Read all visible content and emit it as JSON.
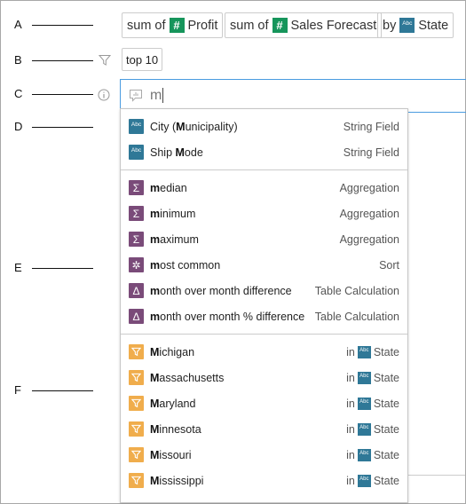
{
  "labels": [
    "A",
    "B",
    "C",
    "D",
    "E",
    "F"
  ],
  "pills": [
    {
      "prefix": "sum of",
      "icon": "number-icon",
      "icon_text": "#",
      "field": "Profit"
    },
    {
      "prefix": "sum of",
      "icon": "number-icon",
      "icon_text": "#",
      "field": "Sales Forecast"
    },
    {
      "prefix": "by",
      "icon": "string-icon",
      "icon_text": "Abc",
      "field": "State"
    }
  ],
  "filter_pill": "top 10",
  "input": {
    "value": "m"
  },
  "colors": {
    "number": "#16955b",
    "string": "#2f7897",
    "aggregation": "#7a4b79",
    "filter": "#f0ad4c",
    "focus": "#4a9ce0"
  },
  "sections": [
    [
      {
        "icon": "string-icon",
        "icon_text": "Abc",
        "pre": "City (",
        "match": "M",
        "post": "unicipality)",
        "type": "String Field"
      },
      {
        "icon": "string-icon",
        "icon_text": "Abc",
        "pre": "Ship ",
        "match": "M",
        "post": "ode",
        "type": "String Field"
      }
    ],
    [
      {
        "icon": "sigma-icon",
        "icon_text": "Σ",
        "pre": "",
        "match": "m",
        "post": "edian",
        "type": "Aggregation"
      },
      {
        "icon": "sigma-icon",
        "icon_text": "Σ",
        "pre": "",
        "match": "m",
        "post": "inimum",
        "type": "Aggregation"
      },
      {
        "icon": "sigma-icon",
        "icon_text": "Σ",
        "pre": "",
        "match": "m",
        "post": "aximum",
        "type": "Aggregation"
      },
      {
        "icon": "sort-icon",
        "icon_text": "✲",
        "pre": "",
        "match": "m",
        "post": "ost common",
        "type": "Sort"
      },
      {
        "icon": "delta-icon",
        "icon_text": "Δ",
        "pre": "",
        "match": "m",
        "post": "onth over month difference",
        "type": "Table Calculation"
      },
      {
        "icon": "delta-icon",
        "icon_text": "Δ",
        "pre": "",
        "match": "m",
        "post": "onth over month % difference",
        "type": "Table Calculation"
      }
    ],
    [
      {
        "icon": "filter-icon",
        "pre": "",
        "match": "M",
        "post": "ichigan",
        "in": "in",
        "field_icon_text": "Abc",
        "field": "State"
      },
      {
        "icon": "filter-icon",
        "pre": "",
        "match": "M",
        "post": "assachusetts",
        "in": "in",
        "field_icon_text": "Abc",
        "field": "State"
      },
      {
        "icon": "filter-icon",
        "pre": "",
        "match": "M",
        "post": "aryland",
        "in": "in",
        "field_icon_text": "Abc",
        "field": "State"
      },
      {
        "icon": "filter-icon",
        "pre": "",
        "match": "M",
        "post": "innesota",
        "in": "in",
        "field_icon_text": "Abc",
        "field": "State"
      },
      {
        "icon": "filter-icon",
        "pre": "",
        "match": "M",
        "post": "issouri",
        "in": "in",
        "field_icon_text": "Abc",
        "field": "State"
      },
      {
        "icon": "filter-icon",
        "pre": "",
        "match": "M",
        "post": "ississippi",
        "in": "in",
        "field_icon_text": "Abc",
        "field": "State"
      }
    ]
  ]
}
